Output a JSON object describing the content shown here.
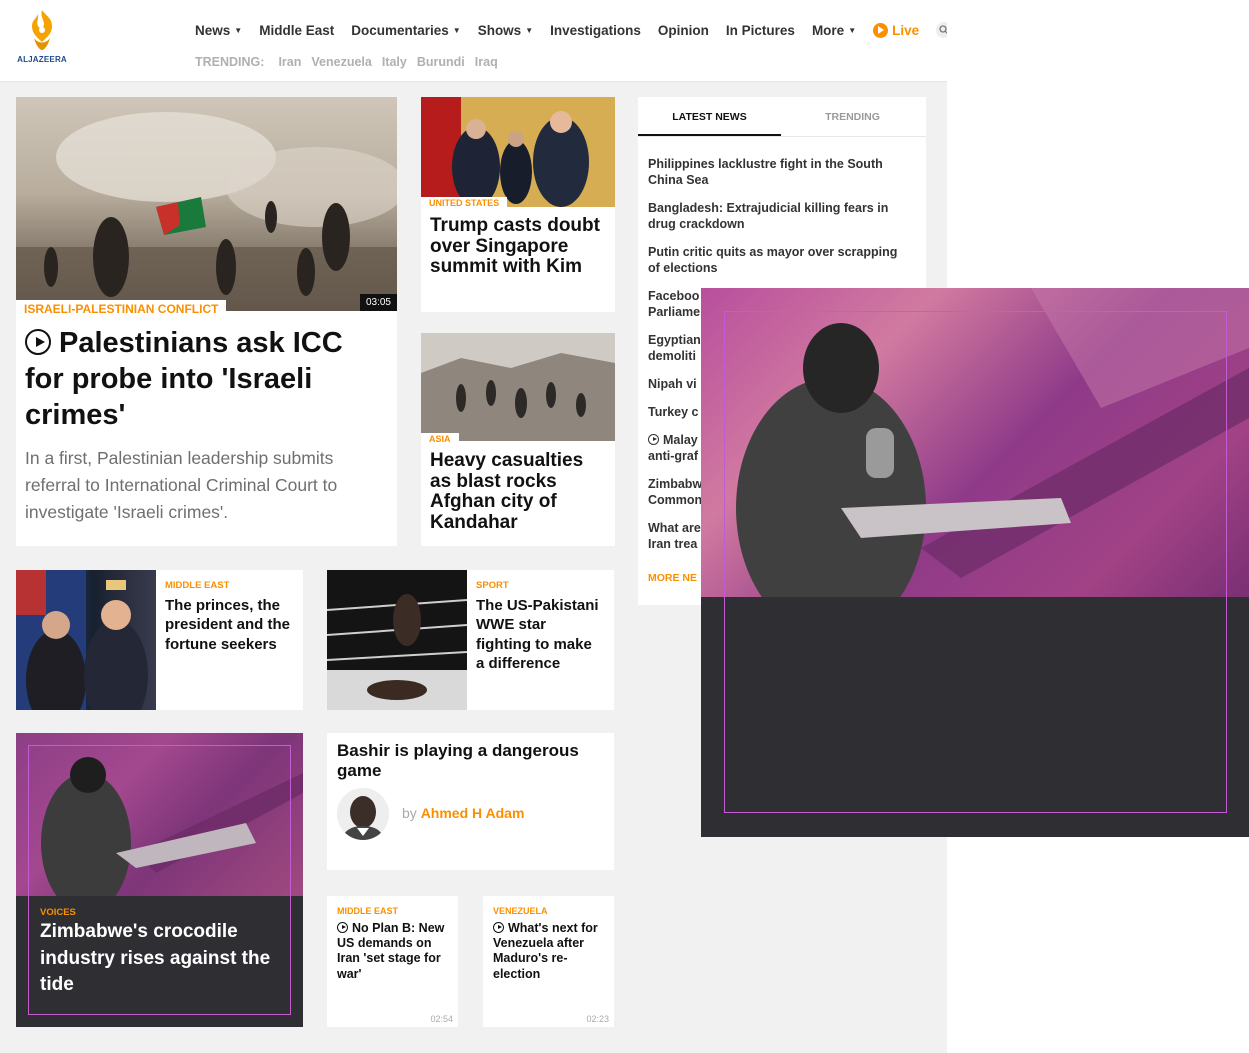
{
  "brand": {
    "name": "ALJAZEERA"
  },
  "nav": {
    "items": [
      "News",
      "Middle East",
      "Documentaries",
      "Shows",
      "Investigations",
      "Opinion",
      "In Pictures",
      "More"
    ],
    "live_label": "Live"
  },
  "trending": {
    "label": "TRENDING:",
    "items": [
      "Iran",
      "Venezuela",
      "Italy",
      "Burundi",
      "Iraq"
    ]
  },
  "hero": {
    "duration": "03:05",
    "tag": "ISRAELI-PALESTINIAN CONFLICT",
    "title": "Palestinians ask ICC for probe into 'Israeli crimes'",
    "summary": "In a first, Palestinian leadership submits referral to International Criminal Court to investigate 'Israeli crimes'."
  },
  "side_cards": [
    {
      "tag": "UNITED STATES",
      "title": "Trump casts doubt over Singapore summit with Kim"
    },
    {
      "tag": "ASIA",
      "title": "Heavy casualties as blast rocks Afghan city of Kandahar"
    }
  ],
  "row_cards": [
    {
      "tag": "MIDDLE EAST",
      "title": "The princes, the president and the fortune seekers"
    },
    {
      "tag": "SPORT",
      "title": "The US-Pakistani WWE star fighting to make a difference"
    }
  ],
  "voices": {
    "tag": "VOICES",
    "title": "Zimbabwe's crocodile industry rises against the tide"
  },
  "opinion": {
    "title": "Bashir is playing a dangerous game",
    "by": "by",
    "author": "Ahmed H Adam"
  },
  "small_cards": [
    {
      "tag": "MIDDLE EAST",
      "title": "No Plan B: New US demands on Iran 'set stage for war'",
      "duration": "02:54"
    },
    {
      "tag": "VENEZUELA",
      "title": "What's next for Venezuela after Maduro's re-election",
      "duration": "02:23"
    }
  ],
  "latest": {
    "tabs": [
      "LATEST NEWS",
      "TRENDING"
    ],
    "items": [
      "Philippines lacklustre fight in the South China Sea",
      "Bangladesh: Extrajudicial killing fears in drug crackdown",
      "Putin critic quits as mayor over scrapping of elections",
      "Faceboo",
      "Parliame",
      "Egyptian",
      "demoliti",
      "Nipah vi",
      "Turkey c",
      "Malay",
      "anti-graf",
      "Zimbabw",
      "Common",
      "What are",
      "Iran trea"
    ],
    "more": "MORE NE"
  },
  "colors": {
    "accent": "#fa9000",
    "voices_bg": "#2f2f33",
    "frame": "#c55bd4",
    "logo_gold": "#f4a300"
  }
}
